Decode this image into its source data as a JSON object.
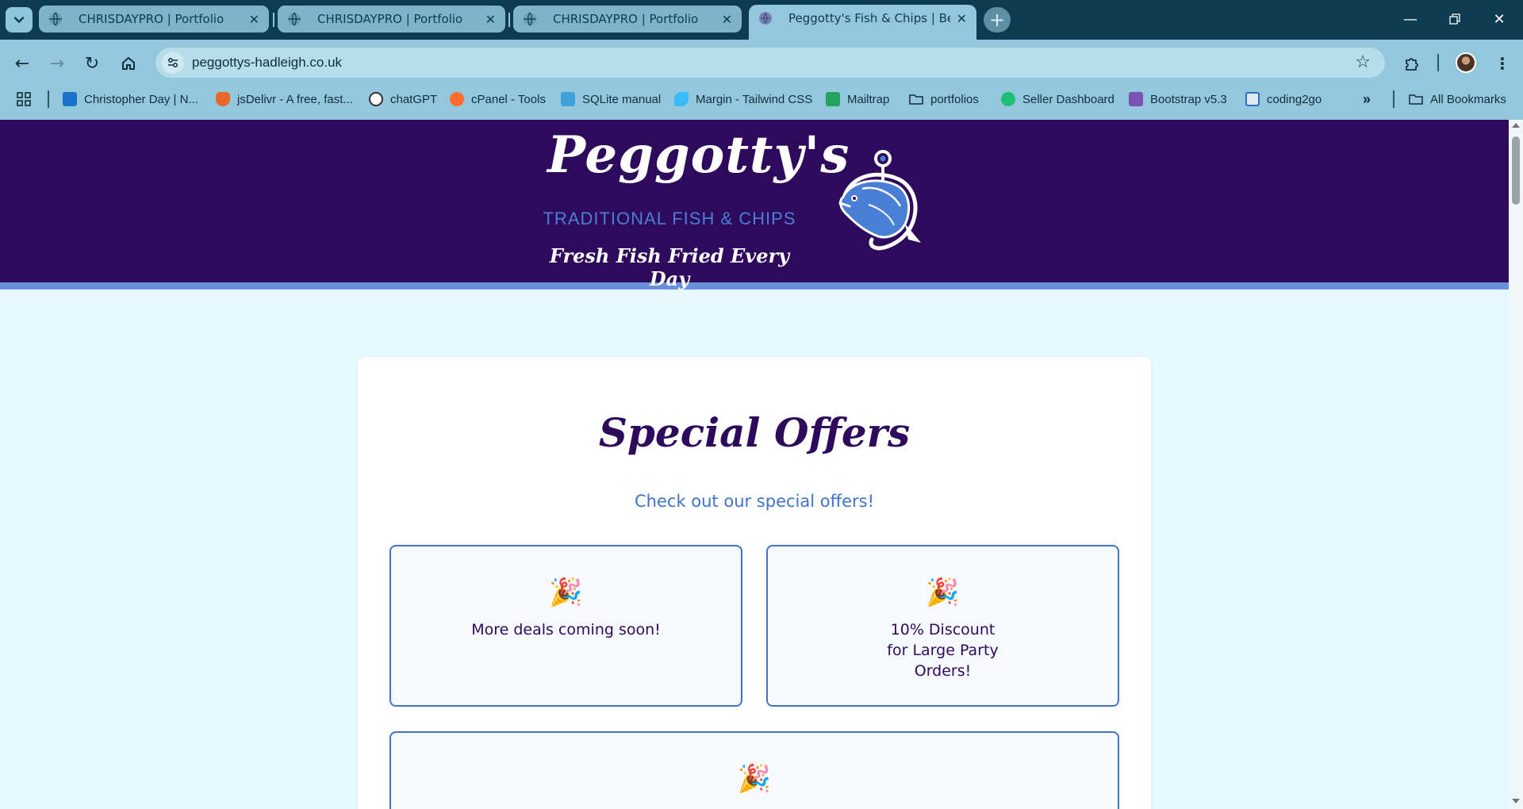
{
  "browser": {
    "tabs": [
      {
        "title": "CHRISDAYPRO | Portfolio",
        "active": false
      },
      {
        "title": "CHRISDAYPRO | Portfolio",
        "active": false
      },
      {
        "title": "CHRISDAYPRO | Portfolio",
        "active": false
      },
      {
        "title": "Peggotty's Fish & Chips | Best T",
        "active": true
      }
    ],
    "url": "peggottys-hadleigh.co.uk",
    "bookmarks": [
      {
        "label": "Christopher Day | N...",
        "icon": "outlook-icon",
        "color": "#1a73c9"
      },
      {
        "label": "jsDelivr - A free, fast...",
        "icon": "jsdelivr-icon",
        "color": "#e8682c"
      },
      {
        "label": "chatGPT",
        "icon": "openai-icon",
        "color": "#ffffff"
      },
      {
        "label": "cPanel - Tools",
        "icon": "cpanel-icon",
        "color": "#ff6c2c"
      },
      {
        "label": "SQLite manual",
        "icon": "sqlite-icon",
        "color": "#3ea1d9"
      },
      {
        "label": "Margin - Tailwind CSS",
        "icon": "tailwind-icon",
        "color": "#38bdf8"
      },
      {
        "label": "Mailtrap",
        "icon": "mailtrap-icon",
        "color": "#22a35e"
      },
      {
        "label": "portfolios",
        "icon": "folder-icon",
        "color": "#0d2f3e"
      },
      {
        "label": "Seller Dashboard",
        "icon": "fiverr-icon",
        "color": "#1dbf73"
      },
      {
        "label": "Bootstrap v5.3",
        "icon": "bootstrap-icon",
        "color": "#7952b3"
      },
      {
        "label": "coding2go",
        "icon": "monitor-icon",
        "color": "#2a6fbf"
      }
    ],
    "all_bookmarks_label": "All Bookmarks"
  },
  "site": {
    "brand": "Peggotty's",
    "subtitle": "TRADITIONAL FISH & CHIPS",
    "tagline": "Fresh Fish Fried Every Day",
    "colors": {
      "header": "#2e0a5c",
      "stripe": "#6c8fdc",
      "accent": "#3f74cc",
      "background": "#e6f7fd"
    }
  },
  "offers": {
    "title": "Special Offers",
    "subtitle": "Check out our special offers!",
    "items": [
      {
        "icon": "party-popper-icon",
        "emoji": "🎉",
        "text": "More deals coming soon!"
      },
      {
        "icon": "party-popper-icon",
        "emoji": "🎉",
        "text": "10% Discount\nfor Large Party\nOrders!"
      },
      {
        "icon": "party-popper-icon",
        "emoji": "🎉",
        "text": ""
      }
    ]
  }
}
